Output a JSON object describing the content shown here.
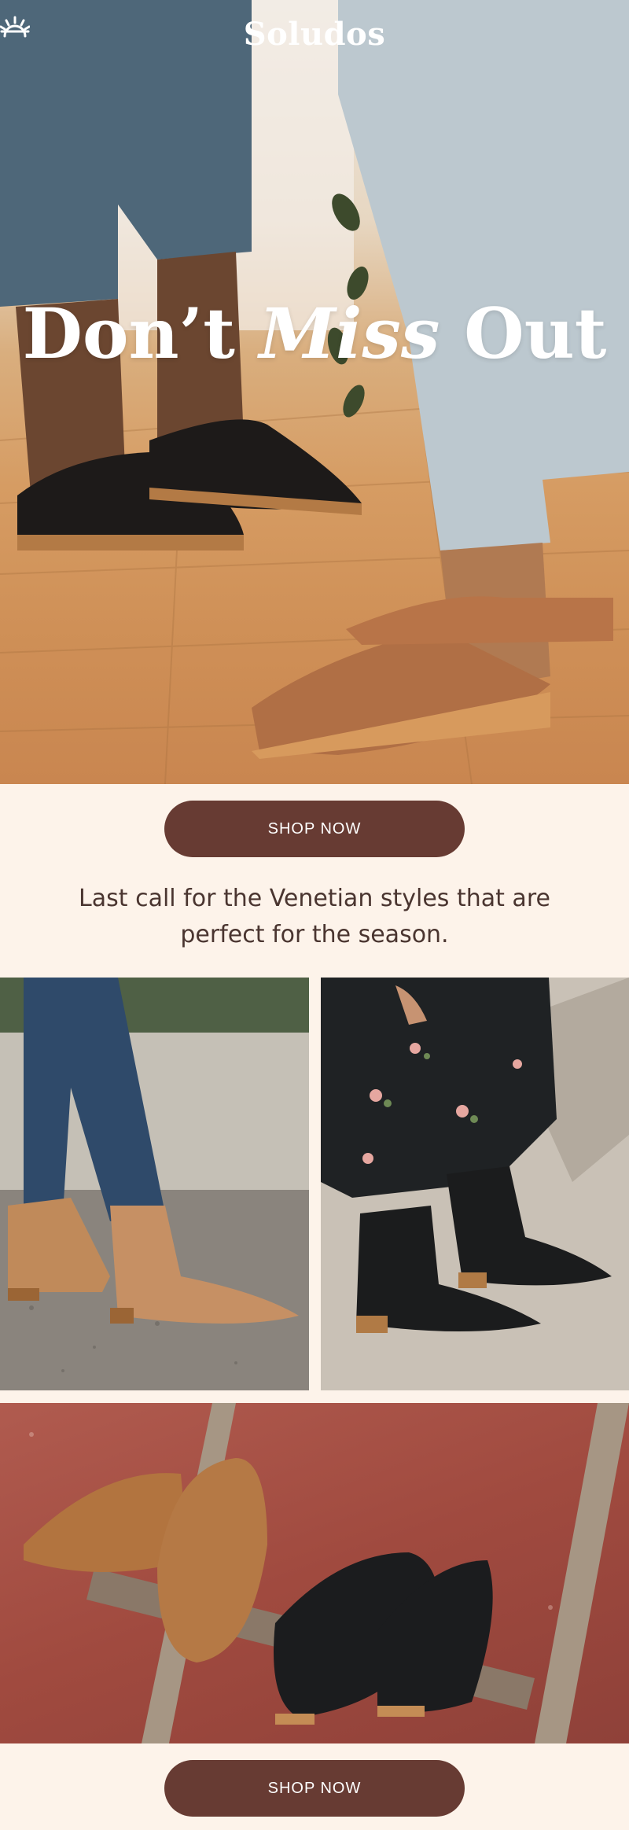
{
  "brand": {
    "logo_text": "Soludos",
    "logo_icon": "sun-icon"
  },
  "hero": {
    "headline_part1": "Don’t ",
    "headline_italic": "Miss",
    "headline_part2": " Out"
  },
  "cta_primary": {
    "label": "SHOP NOW"
  },
  "body": {
    "text": "Last call for the Venetian styles that are perfect for the season."
  },
  "gallery": {
    "items": [
      {
        "subject": "tan suede ankle booties on stone steps"
      },
      {
        "subject": "black leather ankle booties with floral dress"
      },
      {
        "subject": "tan and black leather mules on wooden ladder"
      }
    ]
  },
  "cta_secondary": {
    "label": "SHOP NOW"
  },
  "colors": {
    "background": "#fdf3ea",
    "button": "#673b33",
    "button_text": "#ffffff",
    "body_text": "#4a3530"
  }
}
